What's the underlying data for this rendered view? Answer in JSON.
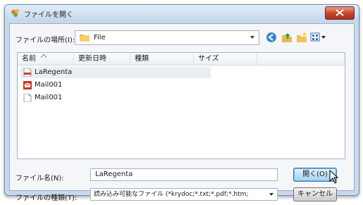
{
  "window": {
    "title": "ファイルを開く",
    "icons": {
      "app": "app-icon",
      "close": "close-x-icon"
    }
  },
  "look_in": {
    "label": "ファイルの場所(I):",
    "value": "File",
    "icons": {
      "folder": "folder-icon",
      "dropdown": "chevron-down-icon"
    }
  },
  "toolbar": {
    "buttons": [
      {
        "name": "back-button",
        "icon": "back-arrow-icon"
      },
      {
        "name": "up-folder-button",
        "icon": "up-folder-icon"
      },
      {
        "name": "new-folder-button",
        "icon": "new-folder-icon"
      },
      {
        "name": "view-menu-button",
        "icon": "view-menu-icon"
      }
    ]
  },
  "list": {
    "columns": [
      "名前",
      "更新日時",
      "種類",
      "サイズ"
    ],
    "files": [
      {
        "name": "LaRegenta",
        "icon": "pdf-document-icon"
      },
      {
        "name": "Mail001",
        "icon": "mail-file-icon"
      },
      {
        "name": "Mail001",
        "icon": "blank-document-icon"
      }
    ]
  },
  "filename": {
    "label": "ファイル名(N):",
    "value": "LaRegenta"
  },
  "filetype": {
    "label": "ファイルの種類(T):",
    "value": "読み込み可能なファイル (*krydoc;*.txt;*.pdf;*.htm;"
  },
  "buttons": {
    "open": "開く(O)",
    "cancel": "キャンセル"
  },
  "colors": {
    "frame": "#c9d9ec",
    "close": "#c0432c",
    "accent": "#3c7fb1"
  }
}
